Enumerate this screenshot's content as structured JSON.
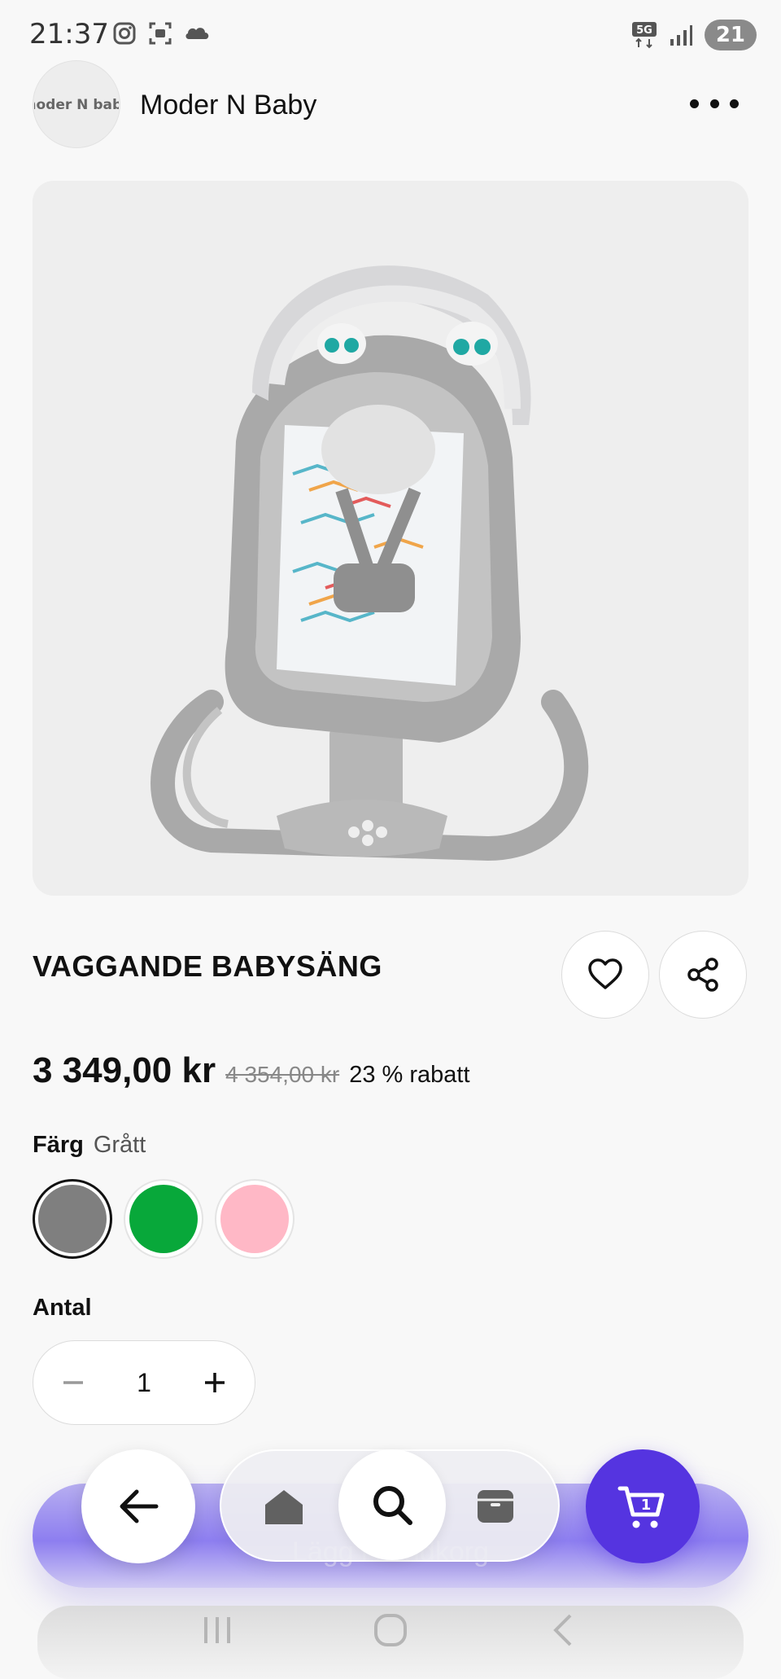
{
  "status_bar": {
    "time": "21:37",
    "network": "5G",
    "battery": "21",
    "left_icons": [
      "instagram-icon",
      "camera-scan-icon",
      "cloud-icon"
    ]
  },
  "store": {
    "name": "Moder N Baby",
    "logo_text": "moder N baby"
  },
  "product": {
    "title": "VAGGANDE BABYSÄNG",
    "price_current": "3 349,00 kr",
    "price_old": "4 354,00 kr",
    "discount": "23 % rabatt"
  },
  "color": {
    "label": "Färg",
    "selected": "Grått",
    "options": [
      {
        "name": "Grått",
        "hex": "#7f7f7f",
        "selected": true
      },
      {
        "name": "Grönt",
        "hex": "#08a83a",
        "selected": false
      },
      {
        "name": "Rosa",
        "hex": "#ffb8c6",
        "selected": false
      }
    ]
  },
  "quantity": {
    "label": "Antal",
    "value": "1",
    "minus": "−",
    "plus": "+"
  },
  "cta": {
    "label": "Lägg i kundkorg"
  },
  "cart": {
    "count": "1"
  },
  "colors": {
    "accent": "#5534e0",
    "background": "#f8f8f8"
  }
}
